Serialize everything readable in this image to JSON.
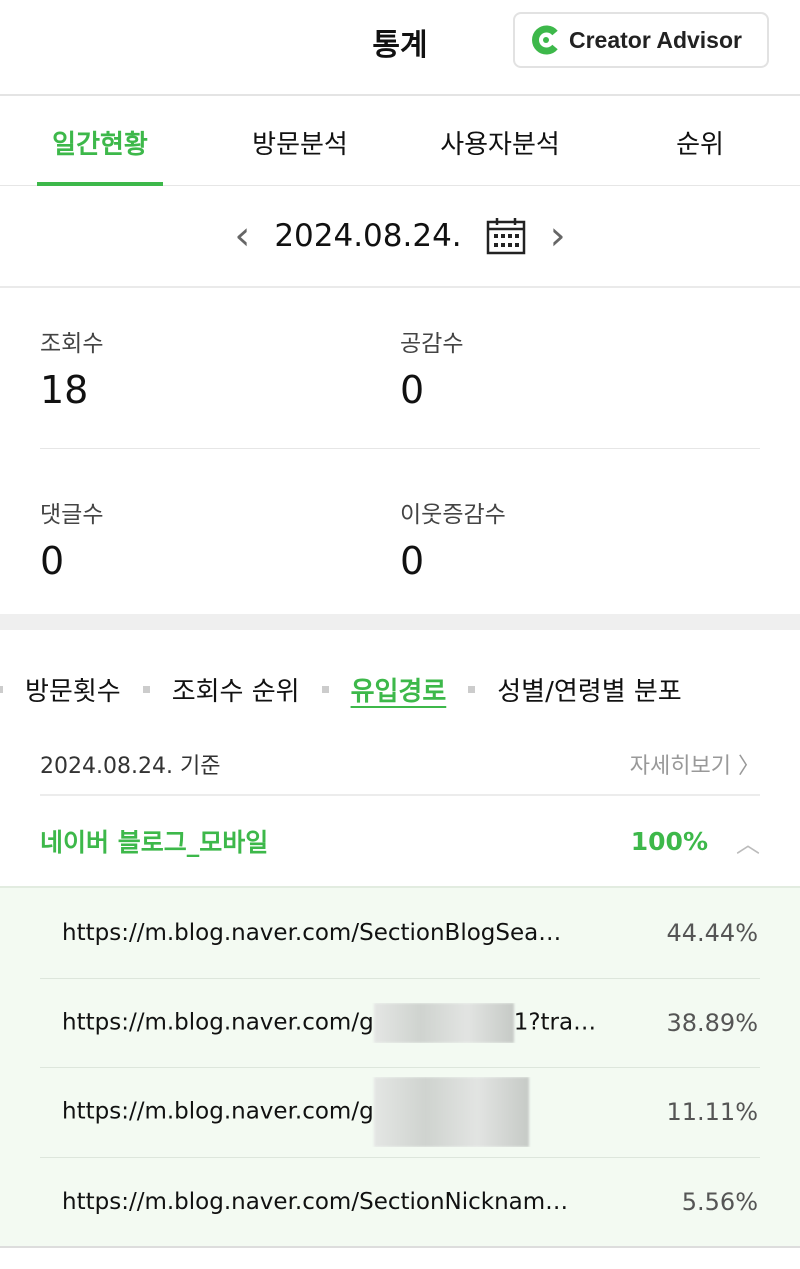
{
  "header": {
    "title": "통계",
    "brand": "Creator Advisor"
  },
  "tabs": [
    "일간현황",
    "방문분석",
    "사용자분석",
    "순위"
  ],
  "date": "2024.08.24.",
  "stats": [
    {
      "label": "조회수",
      "value": "18"
    },
    {
      "label": "공감수",
      "value": "0"
    },
    {
      "label": "댓글수",
      "value": "0"
    },
    {
      "label": "이웃증감수",
      "value": "0"
    }
  ],
  "subtabs": [
    "방문횟수",
    "조회수 순위",
    "유입경로",
    "성별/연령별 분포"
  ],
  "info": {
    "date": "2024.08.24. 기준",
    "more": "자세히보기"
  },
  "group": {
    "name": "네이버 블로그_모바일",
    "percent": "100%"
  },
  "rows": [
    {
      "url": "https://m.blog.naver.com/SectionBlogSea…",
      "pct": "44.44%"
    },
    {
      "url_prefix": "https://m.blog.naver.com/g",
      "url_suffix": "1?tra…",
      "pct": "38.89%"
    },
    {
      "url_prefix": "https://m.blog.naver.com/g",
      "url_suffix": "",
      "pct": "11.11%"
    },
    {
      "url": "https://m.blog.naver.com/SectionNicknam…",
      "pct": "5.56%"
    }
  ],
  "colors": {
    "accent": "#3db84a"
  }
}
